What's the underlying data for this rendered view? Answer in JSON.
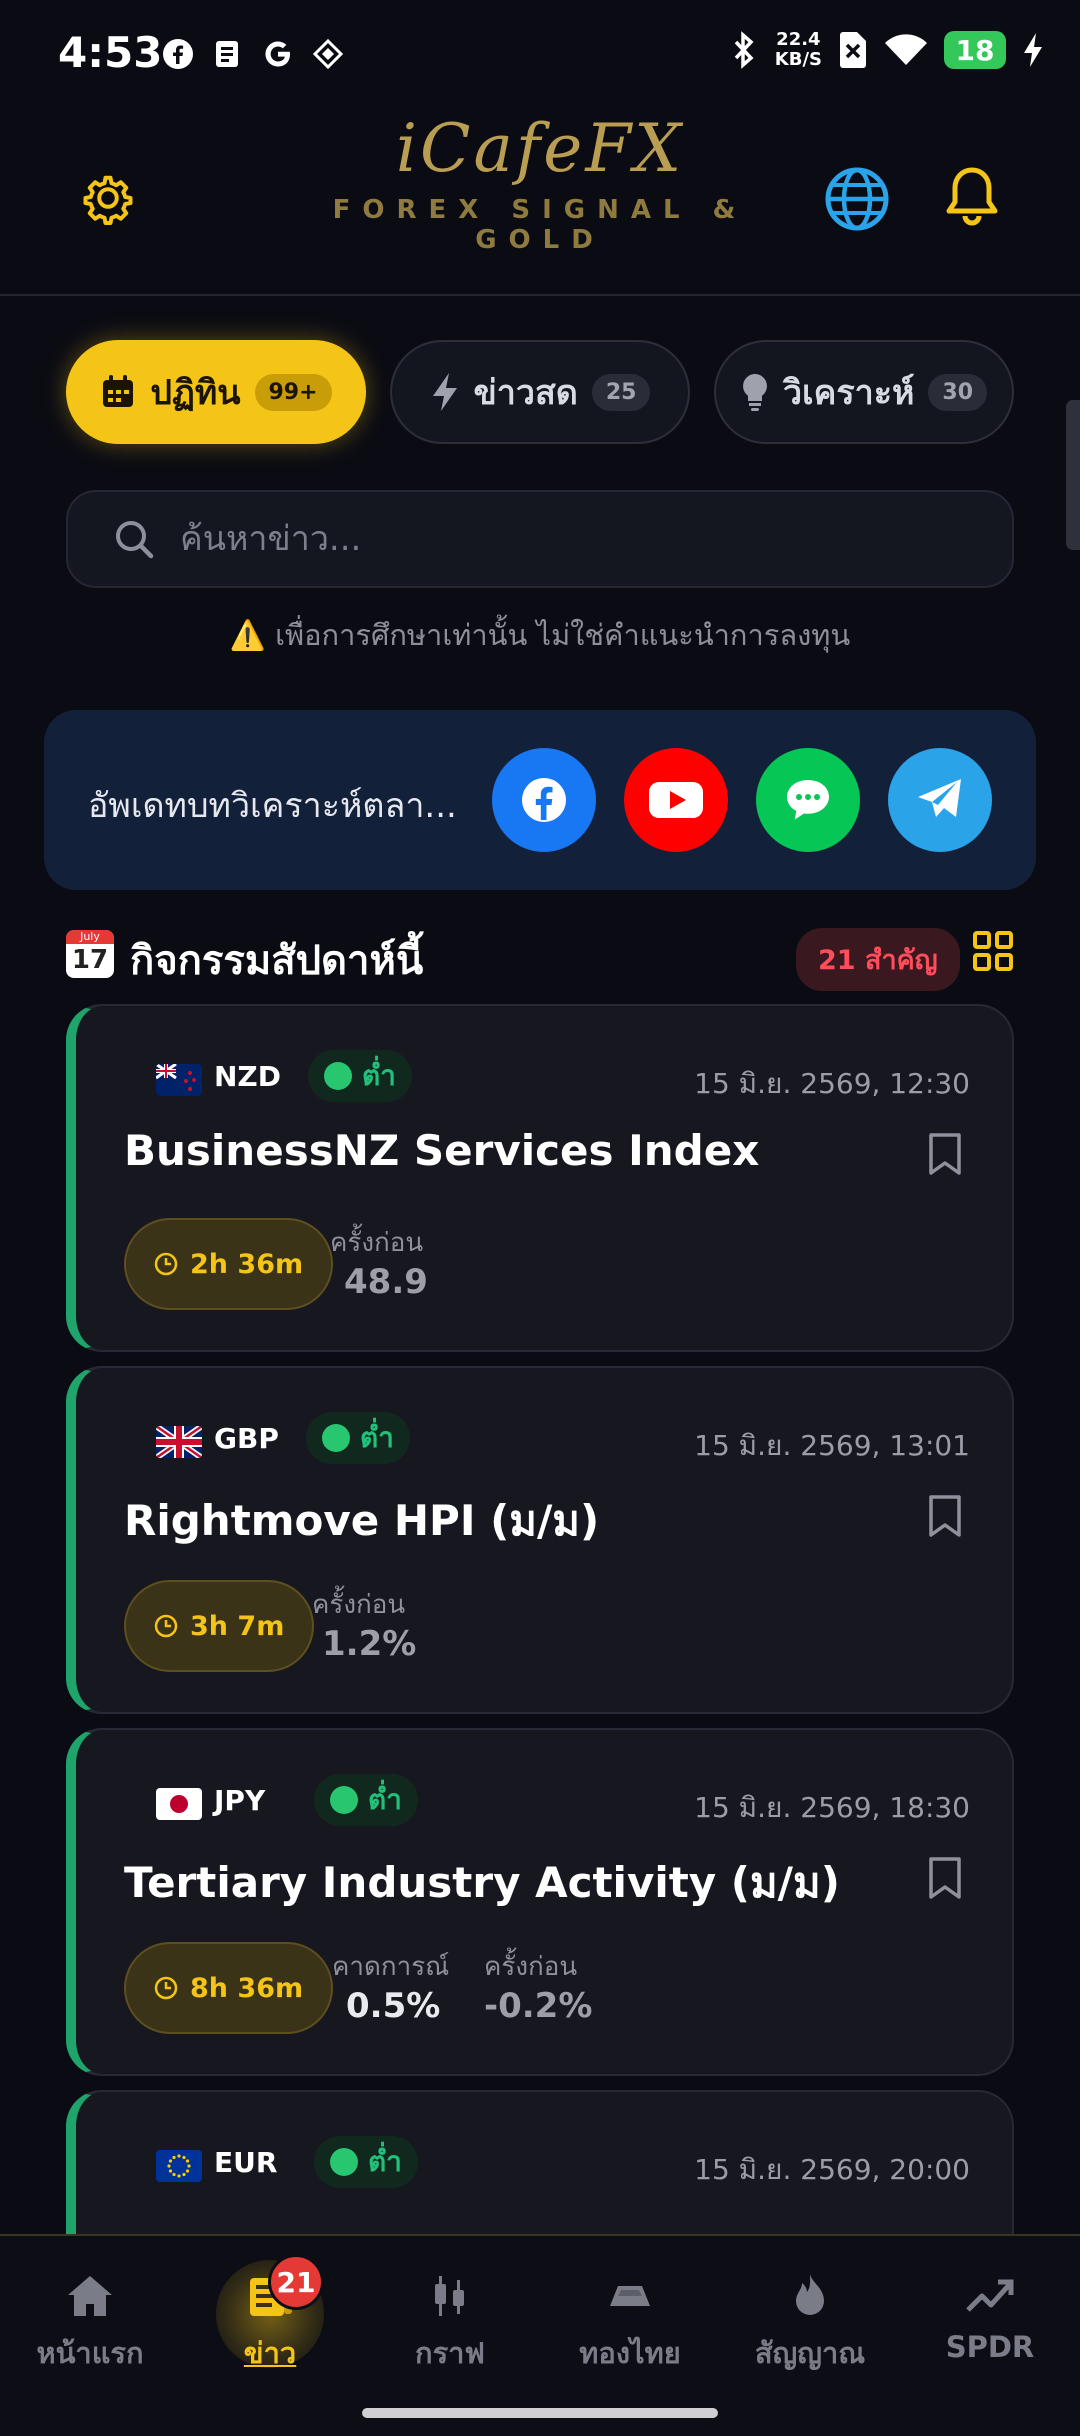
{
  "status_bar": {
    "time": "4:53",
    "net_speed_value": "22.4",
    "net_speed_unit": "KB/S",
    "battery": "18"
  },
  "header": {
    "logo_name": "iCafeFX",
    "logo_sub": "FOREX SIGNAL & GOLD"
  },
  "tabs": [
    {
      "label": "ปฏิทิน",
      "count": "99+",
      "icon": "calendar-icon"
    },
    {
      "label": "ข่าวสด",
      "count": "25",
      "icon": "bolt-icon"
    },
    {
      "label": "วิเคราะห์",
      "count": "30",
      "icon": "bulb-icon"
    }
  ],
  "search": {
    "placeholder": "ค้นหาข่าว..."
  },
  "disclaimer": "⚠️ เพื่อการศึกษาเท่านั้น ไม่ใช่คำแนะนำการลงทุน",
  "social": {
    "text": "อัพเดทบทวิเคราะห์ตลา...",
    "buttons": [
      "facebook",
      "youtube",
      "line",
      "telegram"
    ]
  },
  "section": {
    "title": "กิจกรรมสัปดาห์นี้",
    "important": "21 สำคัญ",
    "cal_month": "July",
    "cal_day": "17"
  },
  "events": [
    {
      "currency": "NZD",
      "impact": "ต่ำ",
      "datetime": "15 มิ.ย. 2569, 12:30",
      "title": "BusinessNZ Services Index",
      "countdown": "2h 36m",
      "previous_label": "ครั้งก่อน",
      "previous": "48.9"
    },
    {
      "currency": "GBP",
      "impact": "ต่ำ",
      "datetime": "15 มิ.ย. 2569, 13:01",
      "title": "Rightmove HPI (ม/ม)",
      "countdown": "3h 7m",
      "previous_label": "ครั้งก่อน",
      "previous": "1.2%"
    },
    {
      "currency": "JPY",
      "impact": "ต่ำ",
      "datetime": "15 มิ.ย. 2569, 18:30",
      "title": "Tertiary Industry Activity (ม/ม)",
      "countdown": "8h 36m",
      "forecast_label": "คาดการณ์",
      "forecast": "0.5%",
      "previous_label": "ครั้งก่อน",
      "previous": "-0.2%"
    },
    {
      "currency": "EUR",
      "impact": "ต่ำ",
      "datetime": "15 มิ.ย. 2569, 20:00"
    }
  ],
  "bottom_nav": [
    {
      "label": "หน้าแรก",
      "icon": "home-icon"
    },
    {
      "label": "ข่าว",
      "icon": "news-icon",
      "badge": "21",
      "active": true
    },
    {
      "label": "กราฟ",
      "icon": "candlestick-icon"
    },
    {
      "label": "ทองไทย",
      "icon": "gold-bar-icon"
    },
    {
      "label": "สัญญาณ",
      "icon": "flame-icon"
    },
    {
      "label": "SPDR",
      "icon": "trend-up-icon"
    }
  ],
  "colors": {
    "accent": "#f4c417",
    "background": "#0b0c13",
    "card": "#16171f",
    "low_impact": "#28c76f",
    "alert": "#e53935"
  }
}
